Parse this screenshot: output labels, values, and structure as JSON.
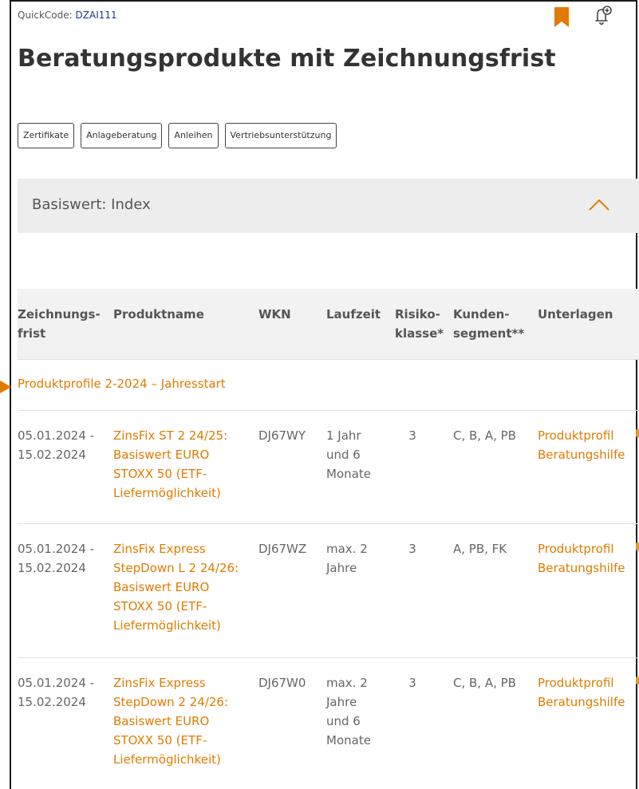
{
  "header": {
    "quickcode_label": "QuickCode:",
    "quickcode_value": "DZAI111",
    "title": "Beratungsprodukte mit Zeichnungsfrist"
  },
  "colors": {
    "accent": "#e07b00",
    "quickcode": "#1a3a8a",
    "accordion_bg": "#ededed",
    "header_bg": "#f2f2f2"
  },
  "tags": [
    "Zertifikate",
    "Anlageberatung",
    "Anleihen",
    "Vertriebsunterstützung"
  ],
  "accordion": {
    "label": "Basiswert: Index",
    "state": "expanded"
  },
  "table": {
    "columns": {
      "frist": [
        "Zeichnungs-",
        "frist"
      ],
      "produkt": "Produktname",
      "wkn": "WKN",
      "laufzeit": "Laufzeit",
      "risiko": [
        "Risiko-",
        "klasse*"
      ],
      "segment": [
        "Kunden-",
        "segment**"
      ],
      "unterlagen": "Unterlagen"
    },
    "group": "Produktprofile 2-2024 – Jahresstart",
    "rows": [
      {
        "frist": [
          "05.01.2024 -",
          "15.02.2024"
        ],
        "produkt": [
          "ZinsFix ST 2 24/25:",
          "Basiswert EURO",
          "STOXX 50 (ETF-",
          "Liefermöglichkeit)"
        ],
        "wkn": "DJ67WY",
        "laufzeit": [
          "1 Jahr",
          "und 6",
          "Monate"
        ],
        "risiko": "3",
        "segment": "C, B, A, PB",
        "links": [
          "Produktprofil",
          "Beratungshilfe"
        ]
      },
      {
        "frist": [
          "05.01.2024 -",
          "15.02.2024"
        ],
        "produkt": [
          "ZinsFix Express",
          "StepDown L 2 24/26:",
          "Basiswert EURO",
          "STOXX 50 (ETF-",
          "Liefermöglichkeit)"
        ],
        "wkn": "DJ67WZ",
        "laufzeit": [
          "max. 2",
          "Jahre"
        ],
        "risiko": "3",
        "segment": "A, PB, FK",
        "links": [
          "Produktprofil",
          "Beratungshilfe"
        ]
      },
      {
        "frist": [
          "05.01.2024 -",
          "15.02.2024"
        ],
        "produkt": [
          "ZinsFix Express",
          "StepDown 2 24/26:",
          "Basiswert EURO",
          "STOXX 50 (ETF-",
          "Liefermöglichkeit)"
        ],
        "wkn": "DJ67W0",
        "laufzeit": [
          "max. 2",
          "Jahre",
          "und 6",
          "Monate"
        ],
        "risiko": "3",
        "segment": "C, B, A, PB",
        "links": [
          "Produktprofil",
          "Beratungshilfe"
        ]
      }
    ]
  }
}
